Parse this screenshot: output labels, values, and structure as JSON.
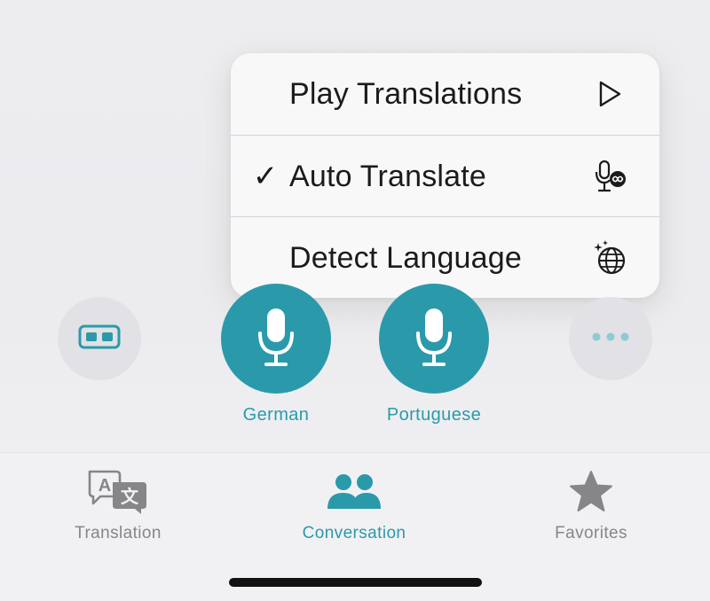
{
  "menu": {
    "items": [
      {
        "label": "Play Translations",
        "checked": false,
        "icon": "play-icon"
      },
      {
        "label": "Auto Translate",
        "checked": true,
        "check_glyph": "✓",
        "icon": "auto-translate-mic-icon"
      },
      {
        "label": "Detect Language",
        "checked": false,
        "icon": "globe-sparkle-icon"
      }
    ]
  },
  "controls": {
    "left_button_icon": "side-by-side-view-icon",
    "more_button_icon": "more-icon",
    "languages": [
      {
        "label": "German",
        "icon": "microphone-icon"
      },
      {
        "label": "Portuguese",
        "icon": "microphone-icon"
      }
    ]
  },
  "tabbar": {
    "tabs": [
      {
        "label": "Translation",
        "icon": "translation-icon",
        "active": false
      },
      {
        "label": "Conversation",
        "icon": "conversation-icon",
        "active": true
      },
      {
        "label": "Favorites",
        "icon": "star-icon",
        "active": false
      }
    ]
  },
  "colors": {
    "accent": "#2a9aab",
    "inactive": "#86868a",
    "menu_text": "#1b1b1b"
  }
}
